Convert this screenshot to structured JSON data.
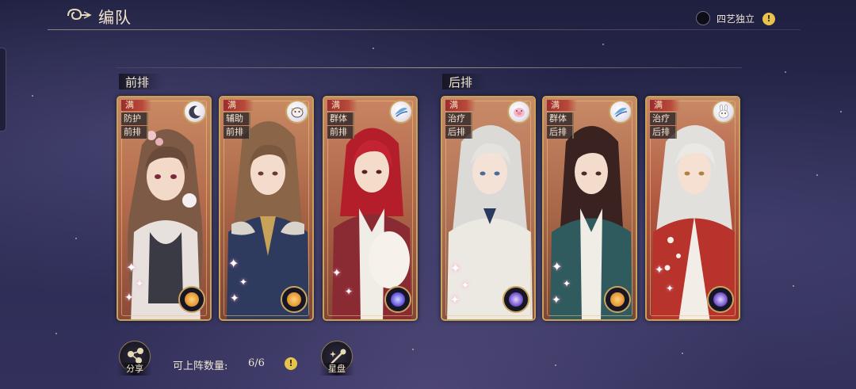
{
  "header": {
    "title": "编队",
    "mode_label": "四艺独立",
    "help_symbol": "!"
  },
  "rows": {
    "front_label": "前排",
    "back_label": "后排"
  },
  "cards": [
    {
      "level": "满",
      "role": "防护",
      "position": "前排",
      "element": "moon-element-icon",
      "orb": "orange"
    },
    {
      "level": "满",
      "role": "辅助",
      "position": "前排",
      "element": "cow-element-icon",
      "orb": "orange"
    },
    {
      "level": "满",
      "role": "群体",
      "position": "前排",
      "element": "fish-element-icon",
      "orb": "purple"
    },
    {
      "level": "满",
      "role": "治疗",
      "position": "后排",
      "element": "pig-element-icon",
      "orb": "purple"
    },
    {
      "level": "满",
      "role": "群体",
      "position": "后排",
      "element": "fish-element-icon",
      "orb": "orange"
    },
    {
      "level": "满",
      "role": "治疗",
      "position": "后排",
      "element": "rabbit-element-icon",
      "orb": "purple"
    }
  ],
  "footer": {
    "share_label": "分享",
    "capacity_label": "可上阵数量:",
    "capacity_value": "6/6",
    "star_label": "星盘",
    "help_symbol": "!"
  },
  "colors": {
    "card_border": "#c9a25a",
    "card_front": "#b76c4c",
    "card_back_red": "#a8533c",
    "accent_gold": "#e8c24a",
    "badge_red": "#9b2e2e"
  }
}
